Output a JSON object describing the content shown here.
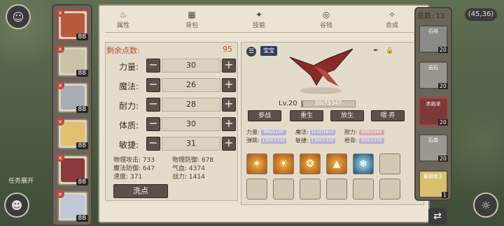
{
  "tabs": [
    "属性",
    "背包",
    "技能",
    "谷钱",
    "合成"
  ],
  "points": {
    "label": "剩余点数:",
    "value": "95"
  },
  "stats": [
    {
      "label": "力量:",
      "value": "30"
    },
    {
      "label": "魔法:",
      "value": "26"
    },
    {
      "label": "耐力:",
      "value": "28"
    },
    {
      "label": "体质:",
      "value": "30"
    },
    {
      "label": "敏捷:",
      "value": "31"
    }
  ],
  "derived": [
    {
      "text": "物理攻击: 733"
    },
    {
      "text": "物理防御: 678"
    },
    {
      "text": "魔法防御: 647"
    },
    {
      "text": "气血: 4374"
    },
    {
      "text": "速度: 371"
    },
    {
      "text": "战力: 1414"
    }
  ],
  "wash_label": "洗点",
  "pet": {
    "level": "Lv.20",
    "exp": "20/75347",
    "exp_fraction": 0.0003,
    "tag": "宝宝"
  },
  "actions": [
    "参战",
    "重生",
    "放生",
    "喂 养"
  ],
  "pet_stats": [
    {
      "label": "力量:",
      "bar": "999/1100"
    },
    {
      "label": "魔法:",
      "bar": "1510/1810"
    },
    {
      "label": "耐力:",
      "bar": "999/1044"
    },
    {
      "label": "弹跳:",
      "bar": "1300/1330"
    },
    {
      "label": "敏捷:",
      "bar": "1300/1330"
    },
    {
      "label": "根骨:",
      "bar": "995/1270"
    }
  ],
  "total": "总数: 13",
  "coord": "(45,36)",
  "left_pets": [
    "88",
    "88",
    "88",
    "88",
    "88",
    "88"
  ],
  "right_pets": [
    {
      "name": "石怪",
      "level": "20"
    },
    {
      "name": "岩石",
      "level": "20"
    },
    {
      "name": "赤焰龙",
      "level": "20"
    },
    {
      "name": "石兽",
      "level": "20"
    },
    {
      "name": "翼狮兽王",
      "level": "1"
    }
  ],
  "side_text": "任务展开"
}
